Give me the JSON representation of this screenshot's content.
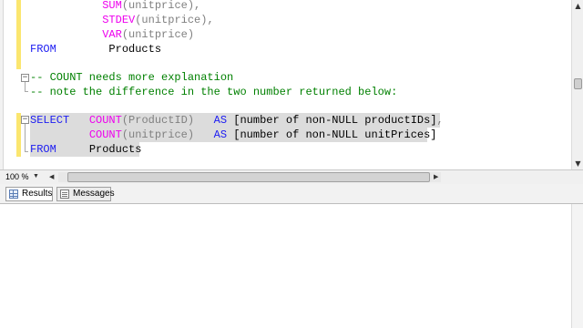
{
  "editor": {
    "lines": [
      {
        "indent": "           ",
        "fn": "SUM",
        "args": "(unitprice),"
      },
      {
        "indent": "           ",
        "fn": "STDEV",
        "args": "(unitprice),"
      },
      {
        "indent": "           ",
        "fn": "VAR",
        "args": "(unitprice)"
      },
      {
        "kw": "FROM",
        "gap": "        ",
        "obj": "Products"
      },
      {
        "comment": "-- COUNT needs more explanation"
      },
      {
        "comment": "-- note the difference in the two number returned below:"
      },
      {
        "kw": "SELECT",
        "gap": "   ",
        "fn": "COUNT",
        "args": "(ProductID)",
        "gap2": "   ",
        "as": "AS",
        "alias": "[number of non-NULL productIDs]",
        "tail": ","
      },
      {
        "gap": "         ",
        "fn": "COUNT",
        "args": "(unitprice)",
        "gap2": "   ",
        "as": "AS",
        "alias": "[number of non-NULL unitPrices]"
      },
      {
        "kw": "FROM",
        "gap": "     ",
        "obj": "Products"
      }
    ]
  },
  "status": {
    "zoom": "100 %",
    "zoom_dropdown_icon": "chevron-down",
    "scroll_left_icon": "arrow-left",
    "scroll_right_icon": "arrow-right"
  },
  "results": {
    "tabs": [
      {
        "label": "Results",
        "icon": "grid-icon",
        "active": true
      },
      {
        "label": "Messages",
        "icon": "messages-icon",
        "active": false
      }
    ]
  },
  "colors": {
    "keyword": "#1d1df2",
    "function": "#ee00ee",
    "comment": "#008000",
    "operator": "#808080",
    "selection": "#dcdcdc",
    "change_bar": "#fbe66f"
  }
}
